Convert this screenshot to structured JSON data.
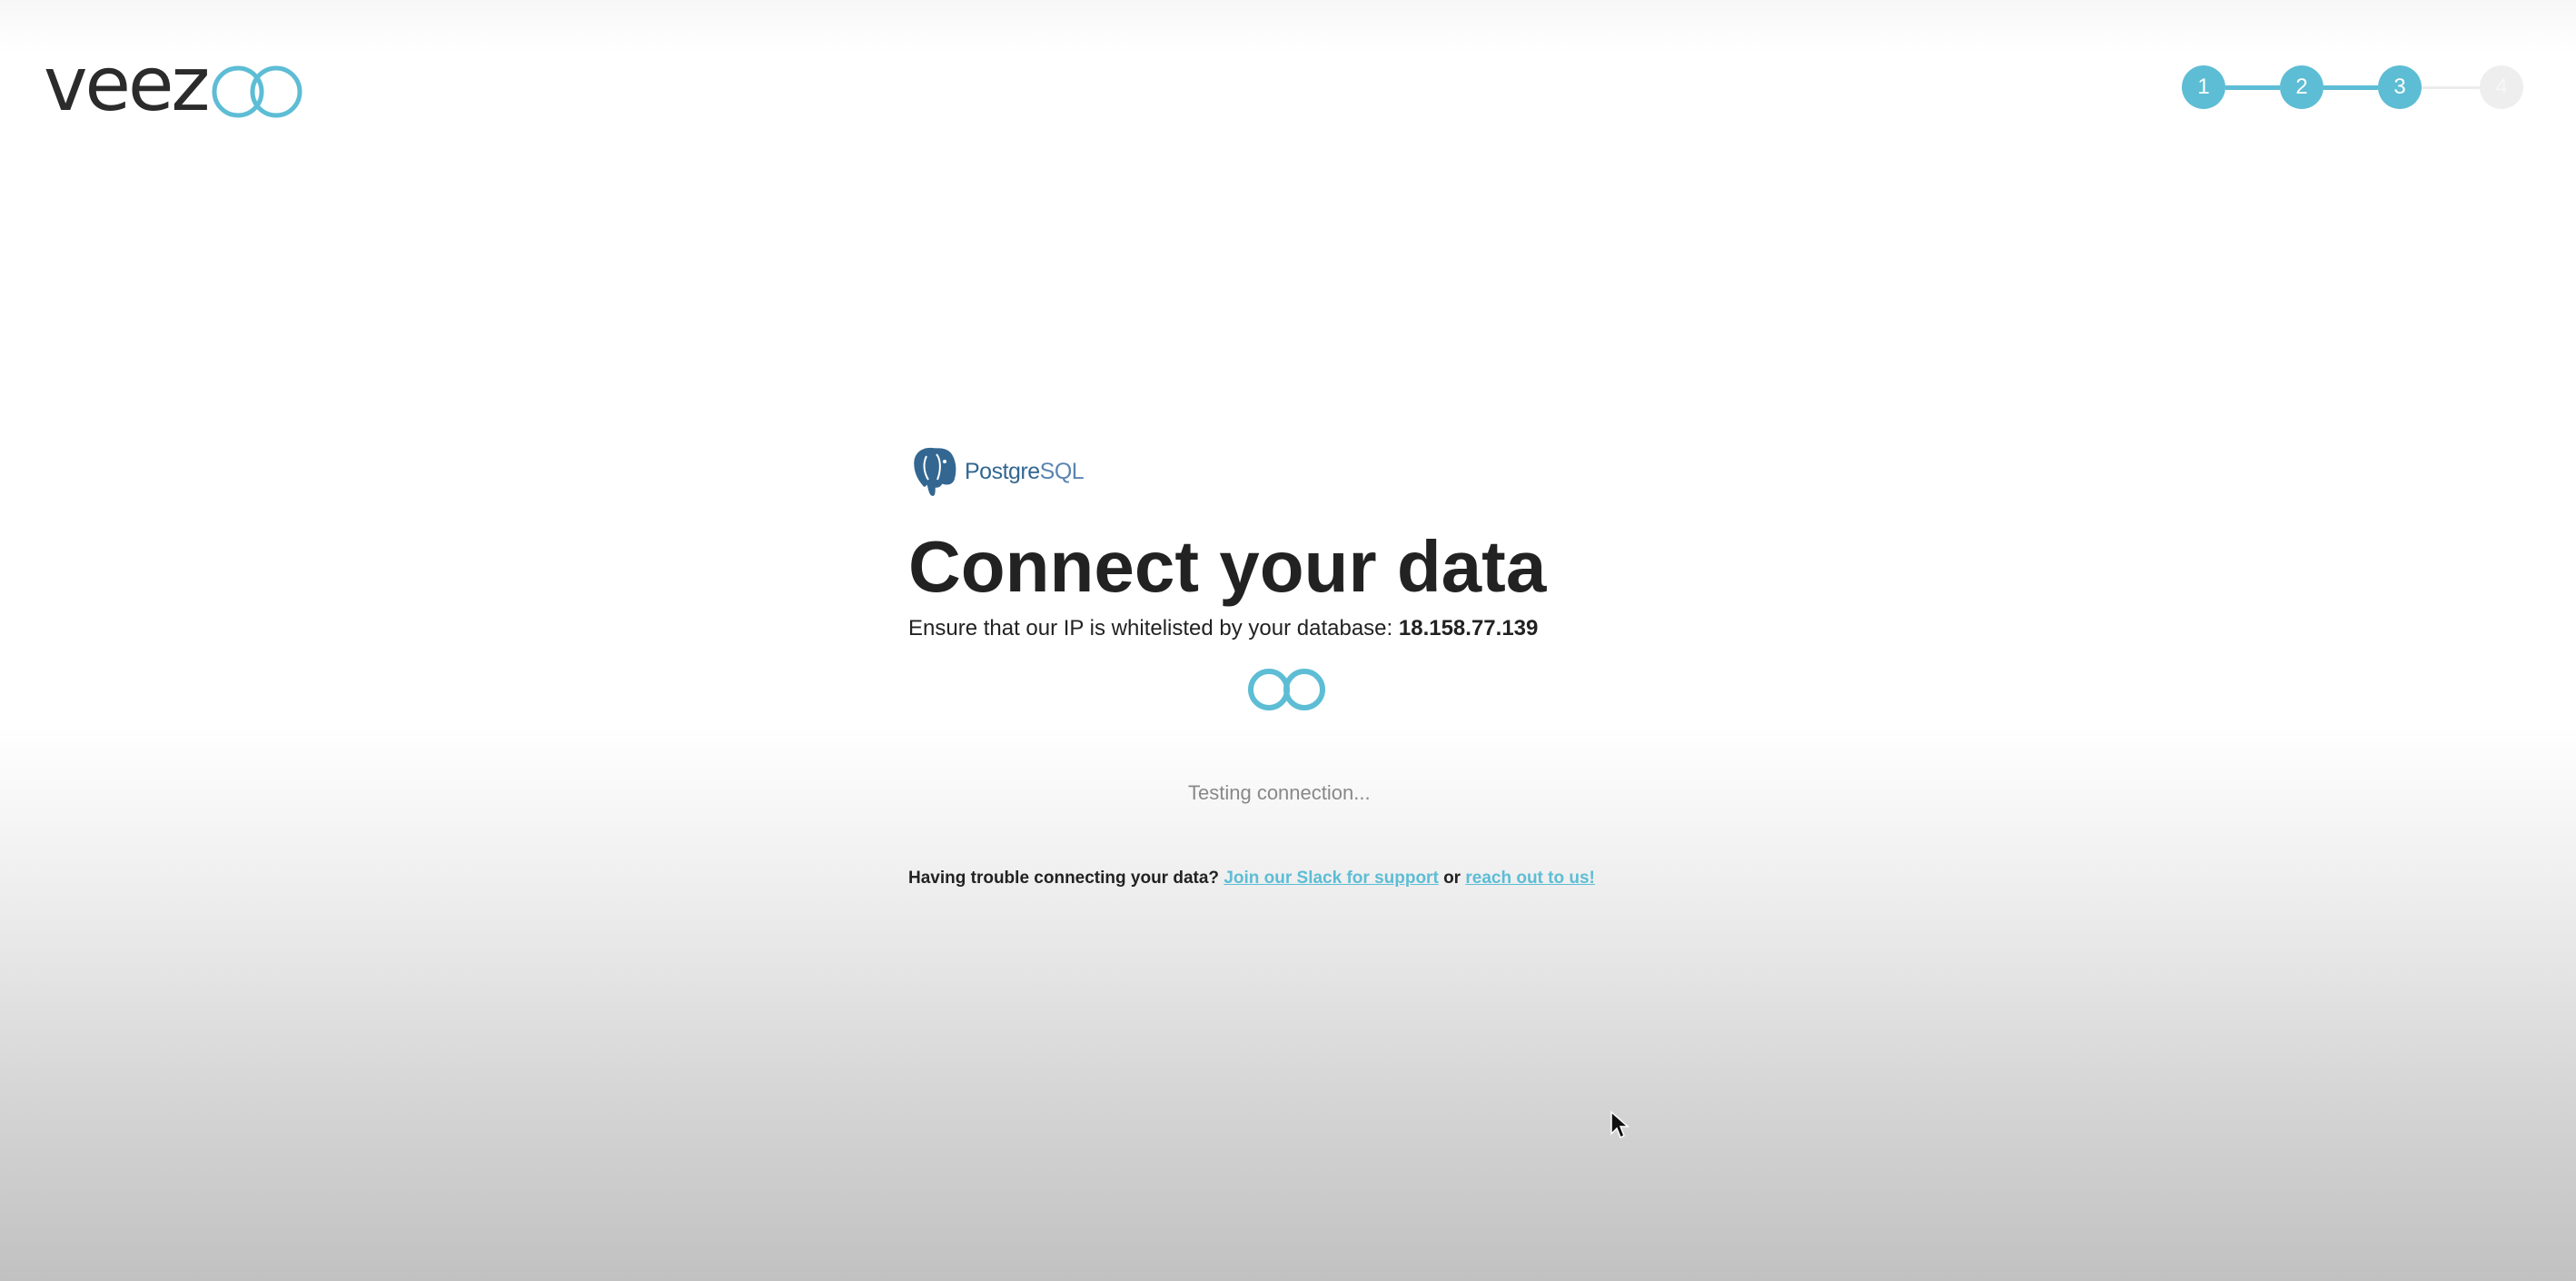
{
  "header": {
    "logo_text": "veez",
    "logo_rings_icon": "double-ring-logo-icon",
    "accent_color": "#5dbdd5"
  },
  "stepper": {
    "steps": [
      {
        "label": "1",
        "state": "completed"
      },
      {
        "label": "2",
        "state": "completed"
      },
      {
        "label": "3",
        "state": "current"
      },
      {
        "label": "4",
        "state": "pending"
      }
    ]
  },
  "main": {
    "db_logo": {
      "icon": "postgresql-elephant-icon",
      "text_prefix": "Postgre",
      "text_suffix": "SQL"
    },
    "title": "Connect your data",
    "ip_instruction": "Ensure that our IP is whitelisted by your database:",
    "ip_address": "18.158.77.139",
    "spinner_icon": "loading-rings-icon",
    "status_text": "Testing connection...",
    "help": {
      "question": "Having trouble connecting your data?",
      "slack_link": "Join our Slack for support",
      "or_text": "or",
      "contact_link": "reach out to us!"
    }
  }
}
